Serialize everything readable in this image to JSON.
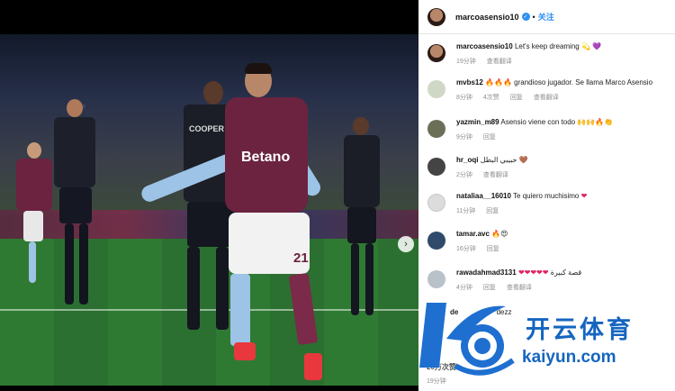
{
  "header": {
    "username": "marcoasensio10",
    "separator": "•",
    "follow_label": "关注"
  },
  "comments": [
    {
      "user": "marcoasensio10",
      "text": "Let's keep dreaming",
      "emoji": "💫 💜",
      "time": "19分钟",
      "likes": "",
      "reply": "",
      "translate": "查看翻译"
    },
    {
      "user": "mvbs12",
      "text": "grandioso jugador. Se llama Marco Asensio",
      "emoji": "🔥🔥🔥",
      "time": "8分钟",
      "likes": "4次赞",
      "reply": "回复",
      "translate": "查看翻译"
    },
    {
      "user": "yazmin_m89",
      "text": "Asensio viene con todo",
      "emoji": "🙌🙌🔥👏",
      "time": "9分钟",
      "likes": "",
      "reply": "回复",
      "translate": ""
    },
    {
      "user": "hr_oqi",
      "text": "حبيبي البطل",
      "emoji": "🤎",
      "time": "2分钟",
      "likes": "",
      "reply": "回复",
      "translate": "查看翻译"
    },
    {
      "user": "nataliaa__16010",
      "text": "Te quiero muchisimo",
      "emoji": "❤",
      "time": "11分钟",
      "likes": "",
      "reply": "回复",
      "translate": ""
    },
    {
      "user": "tamar.avc",
      "text": "",
      "emoji": "🔥😍",
      "time": "16分钟",
      "likes": "",
      "reply": "回复",
      "translate": ""
    },
    {
      "user": "rawadahmad3131",
      "text": "قصة كبيرة",
      "emoji": "❤❤❤❤❤",
      "time": "4分钟",
      "likes": "",
      "reply": "回复",
      "translate": "查看翻译"
    },
    {
      "user": "de",
      "text": "dezz",
      "emoji": "",
      "time": "",
      "likes": "",
      "reply": "",
      "translate": ""
    }
  ],
  "footer": {
    "likes_line": "20万次赞",
    "time": "19分钟"
  },
  "watermark": {
    "brand_cn": "开云体育",
    "brand_en": "kaiyun.com"
  },
  "shirt": {
    "sponsor": "Betano",
    "number": "21",
    "opponent_name": "COOPER"
  },
  "colors": {
    "accent": "#2e8ef2",
    "villa_claret": "#6b2340",
    "villa_blue": "#9dc3e6",
    "watermark_blue": "#1565c0",
    "heart": "#e0245e"
  },
  "icons": {
    "carousel_next": "chevron-right-icon",
    "verified": "verified-badge-icon"
  }
}
